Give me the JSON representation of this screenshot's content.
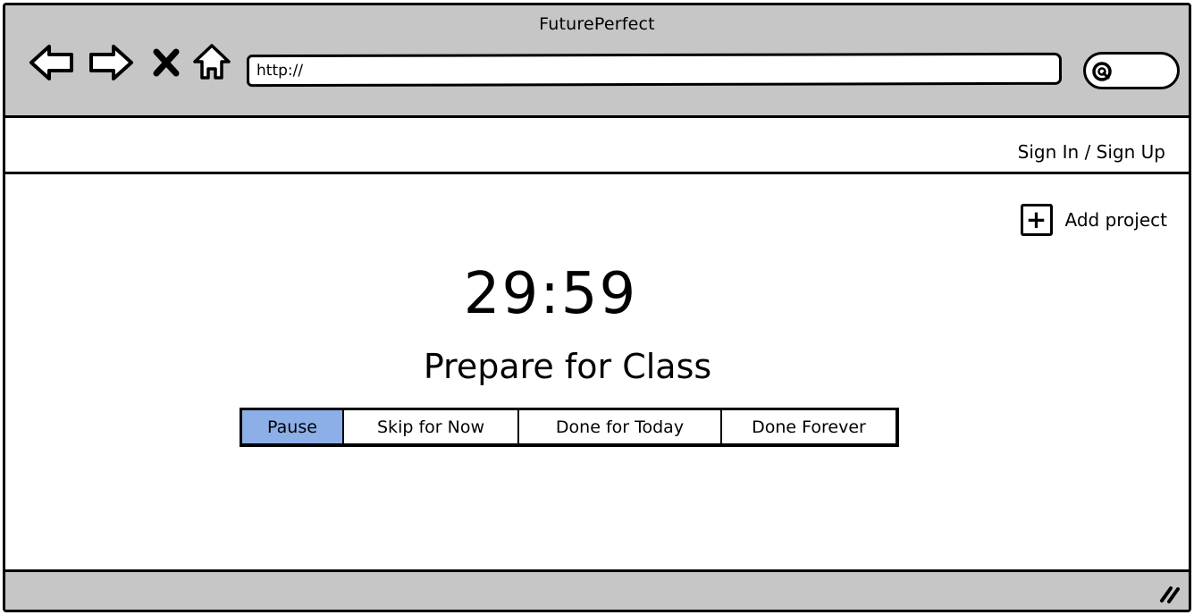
{
  "window": {
    "title": "FuturePerfect"
  },
  "toolbar": {
    "icons": [
      "back-arrow-icon",
      "forward-arrow-icon",
      "close-icon",
      "home-icon"
    ],
    "url": "http://",
    "search_icon": "search-icon"
  },
  "header": {
    "sign_in_label": "Sign In / Sign Up"
  },
  "actions": {
    "add_project_label": "Add project",
    "add_project_icon": "plus-box-icon"
  },
  "timer": {
    "display": "29:59",
    "task": "Prepare for Class"
  },
  "buttons": {
    "pause": "Pause",
    "skip": "Skip for Now",
    "done_today": "Done for Today",
    "done_forever": "Done Forever",
    "active": "pause"
  },
  "colors": {
    "chrome": "#c6c6c6",
    "active_button": "#8cafe8",
    "border": "#000000"
  },
  "statusbar": {
    "grip_icon": "resize-grip-icon"
  }
}
